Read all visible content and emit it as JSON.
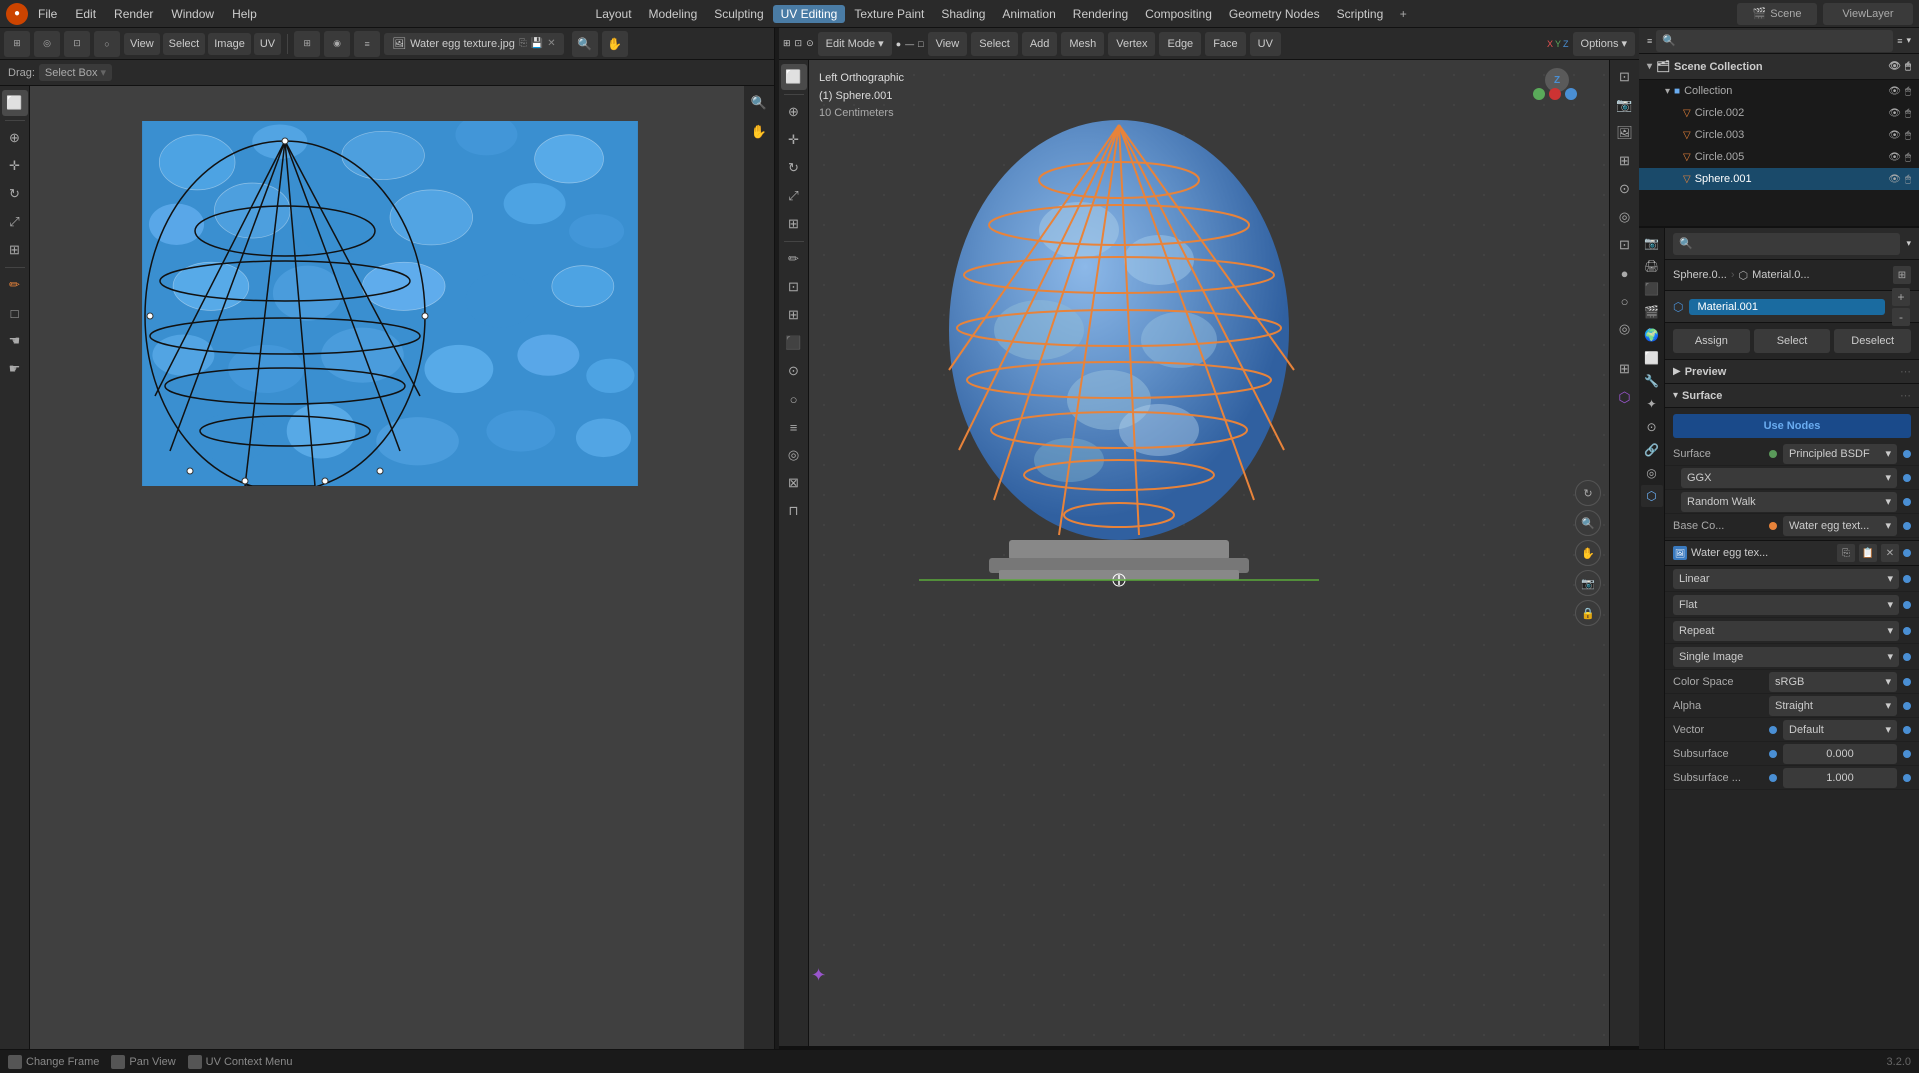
{
  "app": {
    "title": "Blender",
    "version": "3.2.0"
  },
  "top_menu": {
    "items": [
      "File",
      "Edit",
      "Render",
      "Window",
      "Help"
    ],
    "workspaces": [
      "Layout",
      "Modeling",
      "Sculpting",
      "UV Editing",
      "Texture Paint",
      "Shading",
      "Animation",
      "Rendering",
      "Compositing",
      "Geometry Nodes",
      "Scripting"
    ],
    "active_workspace": "UV Editing",
    "scene_label": "Scene",
    "view_layer_label": "ViewLayer"
  },
  "uv_editor": {
    "toolbar_items": [
      "View",
      "Select",
      "Image",
      "UV"
    ],
    "drag_label": "Drag:",
    "select_box_label": "Select Box",
    "filename": "Water egg texture.jpg",
    "zoom_icon": "🔍",
    "hand_icon": "✋"
  },
  "viewport_3d": {
    "mode": "Edit Mode",
    "header_items": [
      "View",
      "Select",
      "Add",
      "Mesh",
      "Vertex",
      "Edge",
      "Face",
      "UV"
    ],
    "info_line1": "Left Orthographic",
    "info_line2": "(1) Sphere.001",
    "info_line3": "10 Centimeters",
    "compass_label": "Z",
    "options_label": "Options"
  },
  "outliner": {
    "title": "Scene Collection",
    "collection_label": "Collection",
    "items": [
      {
        "label": "Circle.002",
        "type": "mesh"
      },
      {
        "label": "Circle.003",
        "type": "mesh"
      },
      {
        "label": "Circle.005",
        "type": "mesh"
      },
      {
        "label": "Sphere.001",
        "type": "sphere",
        "selected": true
      }
    ]
  },
  "properties": {
    "path": [
      "Sphere.0...",
      "Material.0..."
    ],
    "material_name": "Material.001",
    "buttons": {
      "assign": "Assign",
      "select": "Select",
      "deselect": "Deselect"
    },
    "sections": {
      "preview": "Preview",
      "surface": "Surface"
    },
    "use_nodes_label": "Use Nodes",
    "surface_label": "Surface",
    "principled_bsdf": "Principled BSDF",
    "ggx_label": "GGX",
    "random_walk_label": "Random Walk",
    "base_color_label": "Base Co...",
    "water_egg_tex_label": "Water egg text...",
    "texture_node": {
      "title": "Water egg tex...",
      "linear": "Linear",
      "flat": "Flat",
      "repeat": "Repeat",
      "single_image": "Single Image",
      "color_space_label": "Color Space",
      "color_space_value": "sRGB",
      "alpha_label": "Alpha",
      "alpha_value": "Straight",
      "vector_label": "Vector",
      "vector_value": "Default",
      "subsurface_label": "Subsurface",
      "subsurface_value": "0.000",
      "subsurface2_label": "Subsurface ...",
      "subsurface2_value": "1.000"
    }
  },
  "status_bar": {
    "items": [
      {
        "icon": "⬛",
        "label": "Change Frame"
      },
      {
        "icon": "⬛",
        "label": "Pan View"
      },
      {
        "icon": "⬛",
        "label": "UV Context Menu"
      }
    ]
  },
  "colors": {
    "accent_blue": "#4a8fd4",
    "accent_orange": "#e8833a",
    "bg_dark": "#1a1a1a",
    "bg_medium": "#252525",
    "bg_toolbar": "#2a2a2a",
    "water_blue": "#4a90d9",
    "active_tab": "#3a3a3a",
    "selected_item": "#1a4a6a"
  }
}
